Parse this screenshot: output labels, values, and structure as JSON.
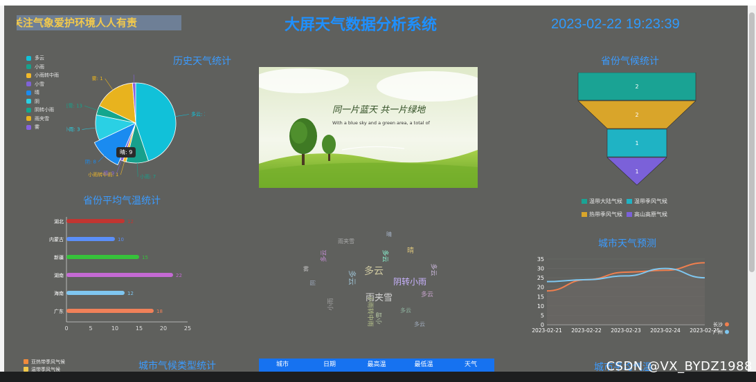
{
  "header": {
    "ticker": "关注气象爱护环境人人有责",
    "title": "大屏天气数据分析系统",
    "datetime": "2023-02-22 19:23:39"
  },
  "panels": {
    "history": "历史天气统计",
    "province_climate": "省份气候统计",
    "province_temp": "省份平均气温统计",
    "city_forecast": "城市天气预测",
    "city_climate_type": "城市气候类型统计",
    "city_partial": "城市平均气温"
  },
  "banner": {
    "slogan": "同一片蓝天 共一片绿地",
    "sub": "With a blue sky and a green area, a total of"
  },
  "watermark": "CSDN @VX_BYDZ1988",
  "tooltip": "晴: 9",
  "colors": {
    "accent": "#1e90ff",
    "panel_bg": "#5f605d",
    "ticker": "#f2c94c"
  },
  "chart_data": [
    {
      "type": "pie",
      "title": "历史天气统计",
      "legend": [
        {
          "name": "多云",
          "color": "#11c1d9"
        },
        {
          "name": "小雨",
          "color": "#18a08c"
        },
        {
          "name": "小雨转中雨",
          "color": "#f2b92a"
        },
        {
          "name": "小雪",
          "color": "#7f63d6"
        },
        {
          "name": "晴",
          "color": "#1a8bf0"
        },
        {
          "name": "阴",
          "color": "#2ad0e4"
        },
        {
          "name": "阴转小雨",
          "color": "#14a68e"
        },
        {
          "name": "雨夹雪",
          "color": "#e8b31e"
        },
        {
          "name": "雾",
          "color": "#8662e0"
        }
      ],
      "slices": [
        {
          "name": "多云",
          "value": 35,
          "color": "#11c1d9"
        },
        {
          "name": "小雨",
          "value": 7,
          "color": "#18a08c"
        },
        {
          "name": "小雨转中雨",
          "value": 1,
          "color": "#f2b92a"
        },
        {
          "name": "小雪",
          "value": 1,
          "color": "#7f63d6"
        },
        {
          "name": "晴",
          "value": 9,
          "color": "#1a8bf0"
        },
        {
          "name": "阴",
          "value": 8,
          "color": "#2ad0e4"
        },
        {
          "name": "阴转小雨",
          "value": 3,
          "color": "#14a68e"
        },
        {
          "name": "雨夹雪",
          "value": 13,
          "color": "#e8b31e"
        },
        {
          "name": "雾",
          "value": 1,
          "color": "#8662e0"
        }
      ],
      "labels": [
        "多云: 35",
        "小雨: 7",
        "小雨转中雨: 1",
        "晴: 9",
        "阴: 8",
        "阴转小雨: 3",
        "雨夹雪: 13",
        "雾: 1",
        "小雪: 1"
      ]
    },
    {
      "type": "funnel",
      "title": "省份气候统计",
      "series": [
        {
          "name": "温带大陆气候",
          "value": 2,
          "color": "#1aa394"
        },
        {
          "name": "热带季风气候",
          "value": 2,
          "color": "#d9a52a"
        },
        {
          "name": "温带季风气候",
          "value": 1,
          "color": "#1fb3c4"
        },
        {
          "name": "高山高原气候",
          "value": 1,
          "color": "#7b61d9"
        }
      ],
      "legend": [
        "温带大陆气候",
        "温带季风气候",
        "热带季风气候",
        "高山高原气候"
      ]
    },
    {
      "type": "bar",
      "orientation": "horizontal",
      "title": "省份平均气温统计",
      "categories": [
        "湖北",
        "内蒙古",
        "新疆",
        "湖南",
        "海南",
        "广东"
      ],
      "values": [
        12,
        10,
        15,
        22,
        12,
        18
      ],
      "colors": [
        "#c23531",
        "#5b8ff9",
        "#36c23a",
        "#c46ad3",
        "#7fc6f0",
        "#f08159"
      ],
      "xlim": [
        0,
        25
      ],
      "xticks": [
        0,
        5,
        10,
        15,
        20,
        25
      ]
    },
    {
      "type": "line",
      "title": "城市天气预测",
      "categories": [
        "2023-02-21",
        "2023-02-22",
        "2023-02-23",
        "2023-02-24",
        "2023-02-25"
      ],
      "series": [
        {
          "name": "长沙",
          "values": [
            18,
            24,
            28,
            29,
            33
          ],
          "color": "#f07f4e"
        },
        {
          "name": "广州",
          "values": [
            23,
            24,
            26,
            30,
            25
          ],
          "color": "#7fc7f0"
        }
      ],
      "ylim": [
        0,
        35
      ],
      "yticks": [
        0,
        5,
        10,
        15,
        20,
        25,
        30,
        35
      ]
    }
  ],
  "word_cloud": [
    "多云",
    "雨夹雪",
    "多云",
    "阴转小雨",
    "多云",
    "晴",
    "小雨",
    "多云",
    "雨夹雪",
    "多云",
    "阴",
    "小雨转中雨",
    "多云",
    "雾",
    "多云",
    "晴",
    "小雪",
    "多云"
  ],
  "climate_legend": [
    "亚热带季风气候",
    "温带季风气候"
  ],
  "table": {
    "headers": [
      "城市",
      "日期",
      "最高温",
      "最低温",
      "天气"
    ]
  }
}
